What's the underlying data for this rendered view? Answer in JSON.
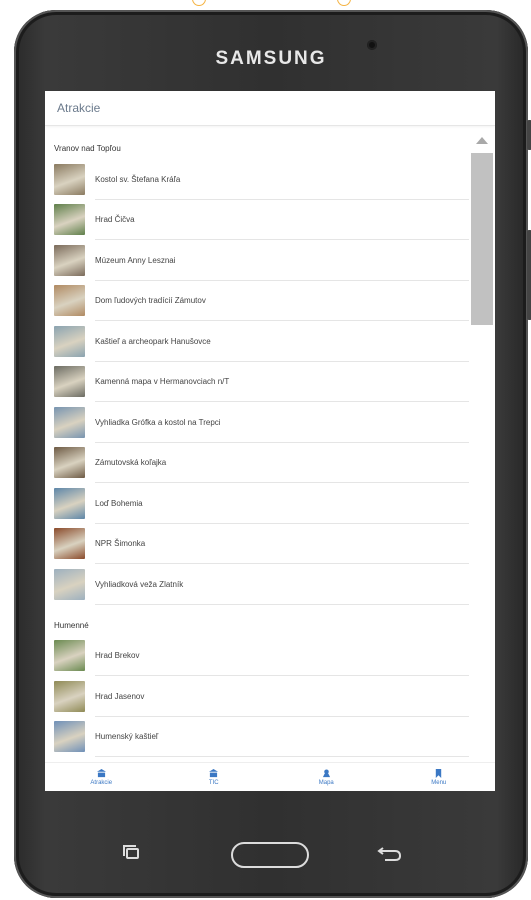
{
  "device": {
    "brand": "SAMSUNG"
  },
  "header": {
    "title": "Atrakcie"
  },
  "sections": [
    {
      "title": "Vranov nad Topľou",
      "items": [
        {
          "label": "Kostol sv. Štefana Kráľa",
          "thumb_color": "#8a7a60"
        },
        {
          "label": "Hrad Čičva",
          "thumb_color": "#5f7f4a"
        },
        {
          "label": "Múzeum Anny Lesznai",
          "thumb_color": "#7a6a5a"
        },
        {
          "label": "Dom ľudových tradícií Zámutov",
          "thumb_color": "#b08a62"
        },
        {
          "label": "Kaštieľ a archeopark Hanušovce",
          "thumb_color": "#8aa3b0"
        },
        {
          "label": "Kamenná mapa v Hermanovciach n/T",
          "thumb_color": "#6b6b62"
        },
        {
          "label": "Vyhliadka Grófka a kostol na Trepci",
          "thumb_color": "#7794b0"
        },
        {
          "label": "Zámutovská koľajka",
          "thumb_color": "#6d5a44"
        },
        {
          "label": "Loď Bohemia",
          "thumb_color": "#5d86a8"
        },
        {
          "label": "NPR Šimonka",
          "thumb_color": "#8a4a2a"
        },
        {
          "label": "Vyhliadková veža Zlatník",
          "thumb_color": "#9db0bf"
        }
      ]
    },
    {
      "title": "Humenné",
      "items": [
        {
          "label": "Hrad Brekov",
          "thumb_color": "#6a8a50"
        },
        {
          "label": "Hrad Jasenov",
          "thumb_color": "#8f8a55"
        },
        {
          "label": "Humenský kaštieľ",
          "thumb_color": "#6f90b8"
        }
      ]
    }
  ],
  "tabs": [
    {
      "label": "Atrakcie",
      "icon": "building-icon"
    },
    {
      "label": "TIC",
      "icon": "building-icon"
    },
    {
      "label": "Mapa",
      "icon": "map-icon"
    },
    {
      "label": "Menu",
      "icon": "bookmark-icon"
    }
  ],
  "colors": {
    "accent": "#3b78c4",
    "header_text": "#6b7a8c"
  }
}
